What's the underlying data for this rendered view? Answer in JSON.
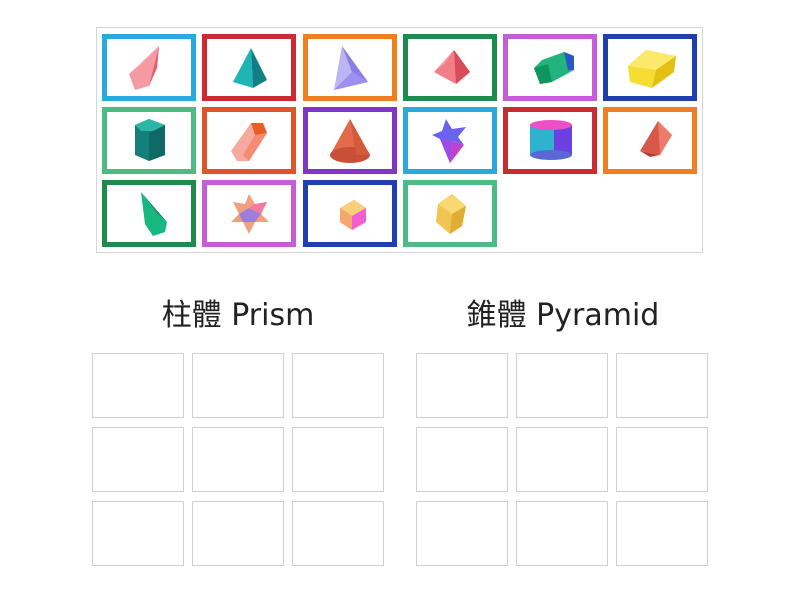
{
  "tiles": [
    {
      "shape": "pentagonal-pyramid-icon",
      "border_color": "#2aa8e0"
    },
    {
      "shape": "triangular-pyramid-icon",
      "border_color": "#cc2a33"
    },
    {
      "shape": "tetrahedron-icon",
      "border_color": "#f07f22"
    },
    {
      "shape": "square-pyramid-icon",
      "border_color": "#1f8a4c"
    },
    {
      "shape": "hexagonal-prism-icon",
      "border_color": "#c55ed6"
    },
    {
      "shape": "rectangular-prism-icon",
      "border_color": "#1f3fb0"
    },
    {
      "shape": "pentagonal-prism-icon",
      "border_color": "#4dbb83"
    },
    {
      "shape": "hexagonal-prism-orange-icon",
      "border_color": "#e0542a"
    },
    {
      "shape": "cone-icon",
      "border_color": "#7e35c8"
    },
    {
      "shape": "star-pyramid-icon",
      "border_color": "#2aa8e0"
    },
    {
      "shape": "cylinder-icon",
      "border_color": "#cc2a33"
    },
    {
      "shape": "triangular-prism-icon",
      "border_color": "#f07f22"
    },
    {
      "shape": "hexagonal-pyramid-icon",
      "border_color": "#1f8a4c"
    },
    {
      "shape": "star-prism-icon",
      "border_color": "#c55ed6"
    },
    {
      "shape": "cube-icon",
      "border_color": "#1f3fb0"
    },
    {
      "shape": "yellow-cube-icon",
      "border_color": "#4dbb83"
    }
  ],
  "groups": [
    {
      "title": "柱體 Prism",
      "slot_count": 9
    },
    {
      "title": "錐體 Pyramid",
      "slot_count": 9
    }
  ]
}
